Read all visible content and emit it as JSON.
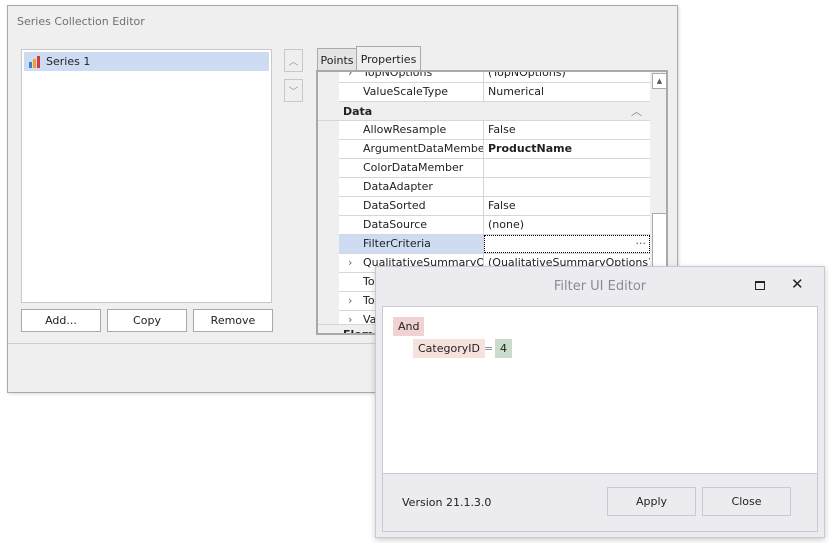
{
  "series_editor": {
    "title": "Series Collection Editor",
    "series_list": [
      {
        "label": "Series 1",
        "icon": "bar-chart-icon",
        "selected": true
      }
    ],
    "buttons": {
      "add": "Add...",
      "copy": "Copy",
      "remove": "Remove"
    },
    "tabs": [
      {
        "label": "Points",
        "active": false
      },
      {
        "label": "Properties",
        "active": true
      }
    ],
    "properties": {
      "top_rows": [
        {
          "name": "TopNOptions",
          "value": "(TopNOptions)",
          "expandable": true
        },
        {
          "name": "ValueScaleType",
          "value": "Numerical",
          "expandable": false
        }
      ],
      "category": "Data",
      "data_rows": [
        {
          "name": "AllowResample",
          "value": "False",
          "expandable": false
        },
        {
          "name": "ArgumentDataMember",
          "value": "ProductName",
          "expandable": false,
          "bold": true
        },
        {
          "name": "ColorDataMember",
          "value": "",
          "expandable": false
        },
        {
          "name": "DataAdapter",
          "value": "",
          "expandable": false
        },
        {
          "name": "DataSorted",
          "value": "False",
          "expandable": false
        },
        {
          "name": "DataSource",
          "value": "(none)",
          "expandable": false
        },
        {
          "name": "FilterCriteria",
          "value": "",
          "expandable": false,
          "selected": true,
          "ellipsis": "..."
        },
        {
          "name": "QualitativeSummaryO...",
          "value": "(QualitativeSummaryOptions)",
          "expandable": true
        },
        {
          "name": "To",
          "value": "",
          "expandable": false
        },
        {
          "name": "To",
          "value": "",
          "expandable": true
        },
        {
          "name": "Va",
          "value": "",
          "expandable": true
        }
      ],
      "next_category": "Eleme"
    }
  },
  "filter_editor": {
    "title": "Filter UI Editor",
    "group_operator": "And",
    "condition": {
      "field": "CategoryID",
      "operator": "=",
      "value": "4"
    },
    "version": "Version 21.1.3.0",
    "buttons": {
      "apply": "Apply",
      "close": "Close"
    },
    "colors": {
      "group": "#f0d2d2",
      "field": "#f6e2dc",
      "value": "#cadccb"
    }
  }
}
